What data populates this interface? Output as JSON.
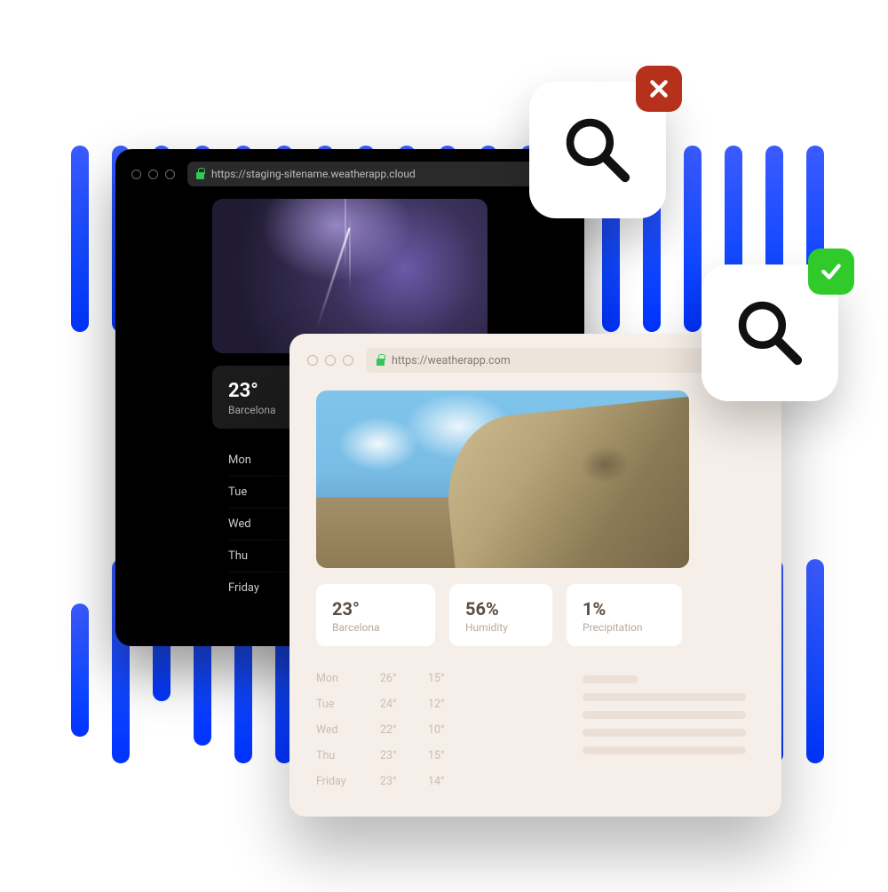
{
  "back_window": {
    "url": "https://staging-sitename.weatherapp.cloud",
    "temperature": "23°",
    "city": "Barcelona",
    "days": [
      "Mon",
      "Tue",
      "Wed",
      "Thu",
      "Friday"
    ]
  },
  "front_window": {
    "url": "https://weatherapp.com",
    "cards": {
      "temperature": {
        "value": "23°",
        "label": "Barcelona"
      },
      "humidity": {
        "value": "56%",
        "label": "Humidity"
      },
      "precip": {
        "value": "1%",
        "label": "Precipitation"
      }
    },
    "forecast": [
      {
        "day": "Mon",
        "hi": "26°",
        "lo": "15°"
      },
      {
        "day": "Tue",
        "hi": "24°",
        "lo": "12°"
      },
      {
        "day": "Wed",
        "hi": "22°",
        "lo": "10°"
      },
      {
        "day": "Thu",
        "hi": "23°",
        "lo": "15°"
      },
      {
        "day": "Friday",
        "hi": "23°",
        "lo": "14°"
      }
    ]
  },
  "colors": {
    "bad": "#b6311c",
    "good": "#30cb2a",
    "blue": "#1248ff"
  }
}
